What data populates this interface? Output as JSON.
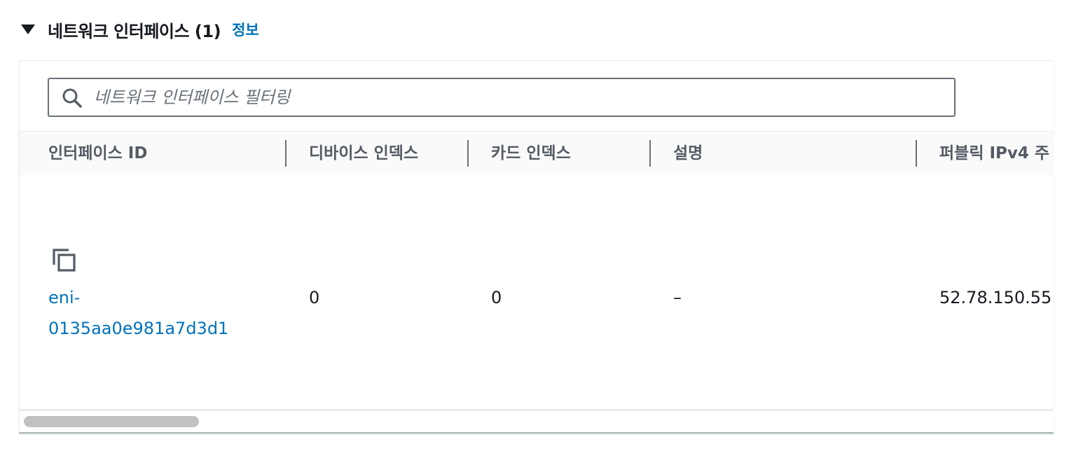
{
  "section": {
    "title": "네트워크 인터페이스 (1)",
    "info_link": "정보"
  },
  "filter": {
    "placeholder": "네트워크 인터페이스 필터링",
    "icon": "search-icon"
  },
  "table": {
    "columns": [
      "인터페이스 ID",
      "디바이스 인덱스",
      "카드 인덱스",
      "설명",
      "퍼블릭 IPv4 주"
    ],
    "rows": [
      {
        "interface_id_line1": "eni-",
        "interface_id_line2": "0135aa0e981a7d3d1",
        "device_index": "0",
        "card_index": "0",
        "description": "–",
        "public_ipv4": "52.78.150.55"
      }
    ]
  },
  "colors": {
    "link": "#0073bb",
    "header_text": "#545b64",
    "body_text": "#16191f"
  }
}
